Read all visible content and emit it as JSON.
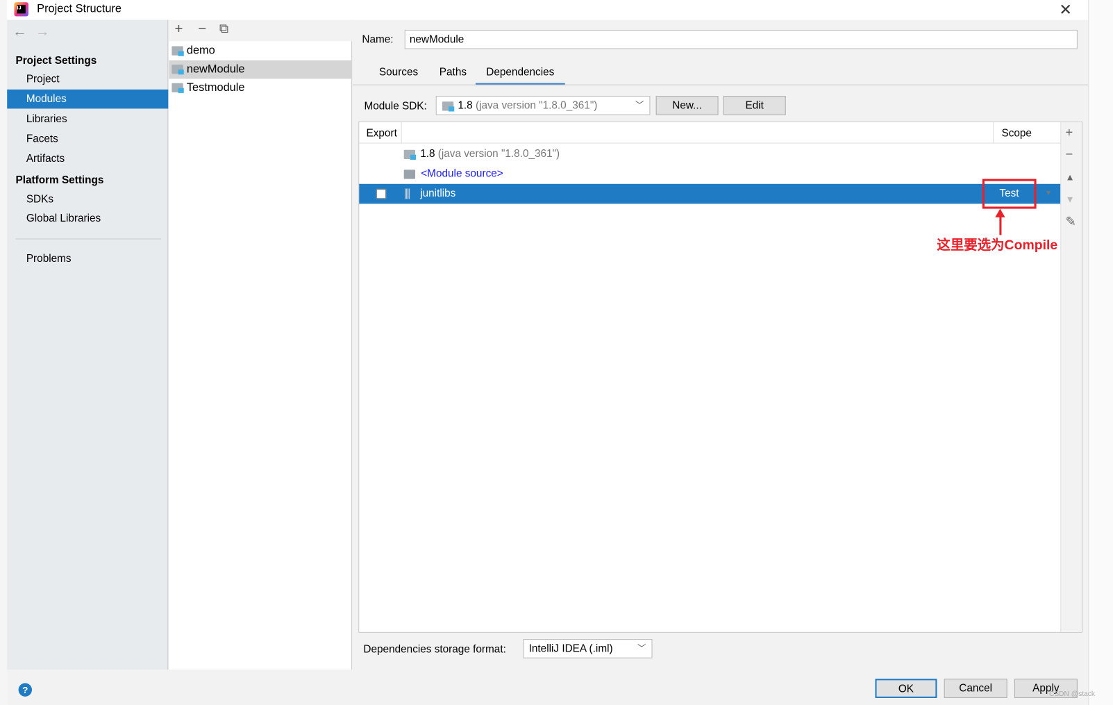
{
  "window": {
    "title": "Project Structure",
    "close": "✕"
  },
  "nav": {
    "back": "←",
    "forward": "→"
  },
  "sidebar": {
    "project_settings": "Project Settings",
    "platform_settings": "Platform Settings",
    "items": [
      "Project",
      "Modules",
      "Libraries",
      "Facets",
      "Artifacts"
    ],
    "platform_items": [
      "SDKs",
      "Global Libraries"
    ],
    "problems": "Problems",
    "selected": "Modules"
  },
  "modules": {
    "toolbar": {
      "add": "+",
      "remove": "−",
      "copy": "⧉"
    },
    "items": [
      "demo",
      "newModule",
      "Testmodule"
    ],
    "selected": "newModule"
  },
  "main": {
    "name_label": "Name:",
    "name_value": "newModule",
    "tabs": [
      "Sources",
      "Paths",
      "Dependencies"
    ],
    "active_tab": "Dependencies",
    "sdk_label": "Module SDK:",
    "sdk_version": "1.8",
    "sdk_detail": "(java version \"1.8.0_361\")",
    "new_button": "New...",
    "edit_button": "Edit",
    "table": {
      "headers": {
        "export": "Export",
        "scope": "Scope"
      },
      "rows": [
        {
          "name": "1.8",
          "detail": "(java version \"1.8.0_361\")"
        },
        {
          "name": "<Module source>"
        },
        {
          "name": "junitlibs",
          "scope": "Test",
          "exported": false,
          "selected": true
        }
      ]
    },
    "side_toolbar": {
      "add": "+",
      "remove": "−",
      "up": "▲",
      "down": "▼",
      "edit": "✎"
    },
    "annotation": "这里要选为Compile",
    "storage_label": "Dependencies storage format:",
    "storage_value": "IntelliJ IDEA (.iml)"
  },
  "footer": {
    "ok": "OK",
    "cancel": "Cancel",
    "apply": "Apply",
    "help": "?"
  },
  "watermark": "CSDN @stack",
  "colors": {
    "selection": "#1e7bc4",
    "annotation": "#e8202a",
    "link": "#1a1aff"
  }
}
